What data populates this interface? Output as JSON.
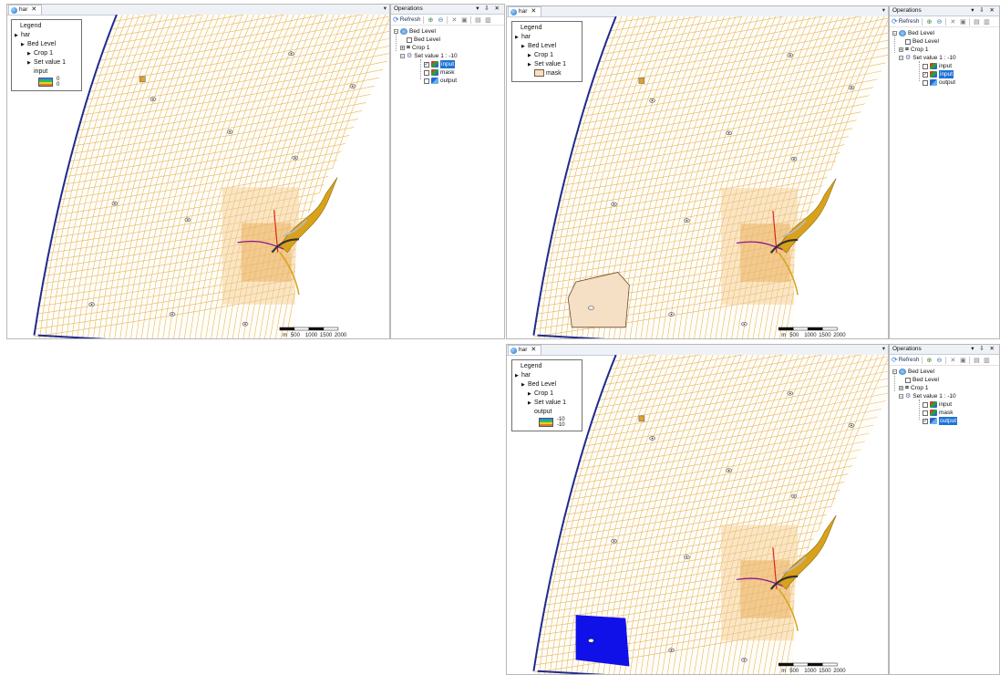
{
  "map_tab": {
    "title": "har",
    "close": "✕",
    "pin": "▾"
  },
  "operations": {
    "title": "Operations",
    "controls": "▾ ⇩ ✕",
    "refresh_label": "Refresh"
  },
  "legend_labels": {
    "title": "Legend",
    "har": "har",
    "bed_level": "Bed Level",
    "crop": "Crop 1",
    "set_value": "Set value 1"
  },
  "scale_bar": {
    "unit": "m",
    "ticks": [
      "500",
      "1000",
      "1500",
      "2000"
    ]
  },
  "views": [
    {
      "legend_layer": "input",
      "legend_values": [
        "0",
        "0"
      ],
      "tree": {
        "bed_level": "Bed Level",
        "crop": "Crop 1",
        "set_value": "Set value 1 : -10",
        "children": [
          {
            "label": "input",
            "checked": true,
            "selected": true
          },
          {
            "label": "mask",
            "checked": false,
            "selected": false
          },
          {
            "label": "output",
            "checked": false,
            "selected": false
          }
        ]
      }
    },
    {
      "legend_layer": "mask",
      "legend_values": [],
      "tree": {
        "root": "Bed Level",
        "bed_level": "Bed Level",
        "crop": "Crop 1",
        "set_value": "Set value 1 : -10",
        "children": [
          {
            "label": "input",
            "checked": false,
            "selected": false
          },
          {
            "label": "input",
            "checked": true,
            "selected": true
          },
          {
            "label": "output",
            "checked": false,
            "selected": false
          }
        ]
      }
    },
    {
      "legend_layer": "output",
      "legend_values": [
        "-10",
        "-10"
      ],
      "tree": {
        "root": "Bed Level",
        "bed_level": "Bed Level",
        "crop": "Crop 1",
        "set_value": "Set value 1 : -10",
        "children": [
          {
            "label": "input",
            "checked": false,
            "selected": false
          },
          {
            "label": "mask",
            "checked": false,
            "selected": false
          },
          {
            "label": "output",
            "checked": true,
            "selected": true
          }
        ]
      }
    }
  ],
  "colors": {
    "grid": "#e7b75f",
    "coast": "#1f2a8f",
    "mask_fill": "#f5dfc5",
    "output_fill": "#1010e8",
    "selection": "#1f73d6"
  }
}
